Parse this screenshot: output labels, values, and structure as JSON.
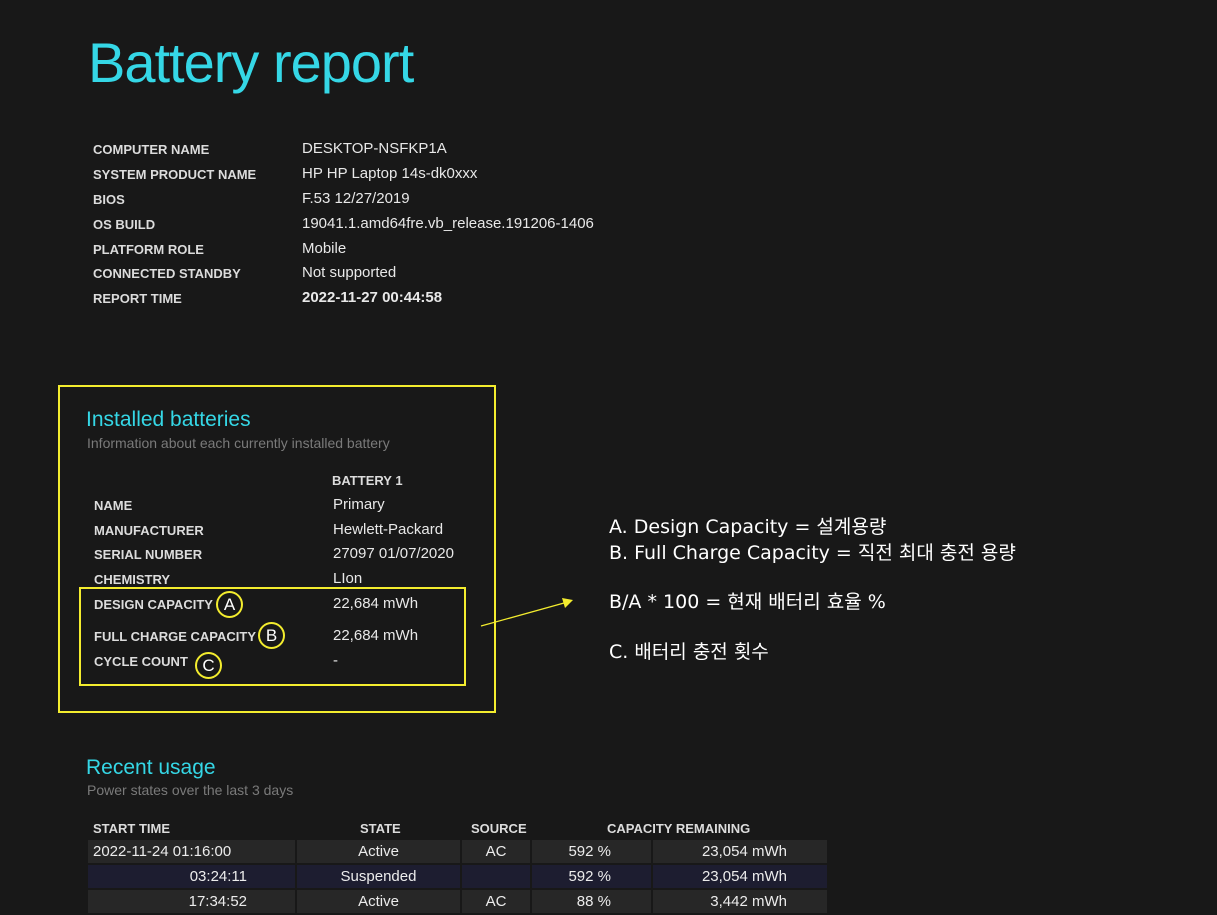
{
  "report": {
    "title": "Battery report",
    "computer_info": [
      {
        "label": "COMPUTER NAME",
        "value": "DESKTOP-NSFKP1A"
      },
      {
        "label": "SYSTEM PRODUCT NAME",
        "value": "HP HP Laptop 14s-dk0xxx"
      },
      {
        "label": "BIOS",
        "value": "F.53 12/27/2019"
      },
      {
        "label": "OS BUILD",
        "value": "19041.1.amd64fre.vb_release.191206-1406"
      },
      {
        "label": "PLATFORM ROLE",
        "value": "Mobile"
      },
      {
        "label": "CONNECTED STANDBY",
        "value": "Not supported"
      },
      {
        "label": "REPORT TIME",
        "value": "2022-11-27  00:44:58"
      }
    ]
  },
  "installed_batteries": {
    "title": "Installed batteries",
    "subtitle": "Information about each currently installed battery",
    "column": "BATTERY 1",
    "rows": [
      {
        "label": "NAME",
        "value": "Primary"
      },
      {
        "label": "MANUFACTURER",
        "value": "Hewlett-Packard"
      },
      {
        "label": "SERIAL NUMBER",
        "value": "27097 01/07/2020"
      },
      {
        "label": "CHEMISTRY",
        "value": "LIon"
      },
      {
        "label": "DESIGN CAPACITY",
        "value": "22,684 mWh",
        "marker": "A"
      },
      {
        "label": "FULL CHARGE CAPACITY",
        "value": "22,684 mWh",
        "marker": "B"
      },
      {
        "label": "CYCLE COUNT",
        "value": "-",
        "marker": "C"
      }
    ]
  },
  "annotations": {
    "lines": [
      "A. Design Capacity = 설계용량",
      "B. Full Charge Capacity = 직전 최대 충전 용량",
      "B/A * 100 = 현재 배터리 효율 %",
      "C. 배터리 충전 횟수"
    ],
    "accent_color": "#f3ec2e"
  },
  "recent_usage": {
    "title": "Recent usage",
    "subtitle": "Power states over the last 3 days",
    "headers": {
      "start_time": "START TIME",
      "state": "STATE",
      "source": "SOURCE",
      "capacity": "CAPACITY REMAINING"
    },
    "rows": [
      {
        "start_time": "2022-11-24  01:16:00",
        "state": "Active",
        "source": "AC",
        "percent": "592 %",
        "mwh": "23,054 mWh"
      },
      {
        "start_time": "03:24:11",
        "state": "Suspended",
        "source": "",
        "percent": "592 %",
        "mwh": "23,054 mWh"
      },
      {
        "start_time": "17:34:52",
        "state": "Active",
        "source": "AC",
        "percent": "88 %",
        "mwh": "3,442 mWh"
      }
    ]
  },
  "colors": {
    "background": "#181818",
    "heading": "#35d7e6",
    "highlight_box": "#f3ec2e"
  }
}
